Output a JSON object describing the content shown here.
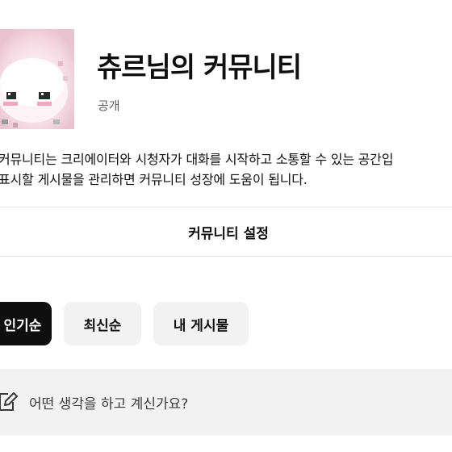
{
  "community": {
    "title": "츄르님의 커뮤니티",
    "visibility": "공개",
    "description_line1": "커뮤니티는 크리에이터와 시청자가 대화를 시작하고 소통할 수 있는 공간입",
    "description_line2": "표시할 게시물을 관리하면 커뮤니티 성장에 도움이 됩니다."
  },
  "settings": {
    "label": "커뮤니티 설정"
  },
  "filters": {
    "popular": "인기순",
    "latest": "최신순",
    "mine": "내 게시물",
    "selected": "popular"
  },
  "compose": {
    "placeholder": "어떤 생각을 하고 계신가요?",
    "icon": "edit-icon"
  },
  "colors": {
    "text": "#0f0f0f",
    "secondary_text": "#606060",
    "chip_selected_bg": "#0f0f0f",
    "chip_bg": "#f2f2f2",
    "divider": "#e5e5e5",
    "avatar_pink": "#f3d8e0"
  }
}
